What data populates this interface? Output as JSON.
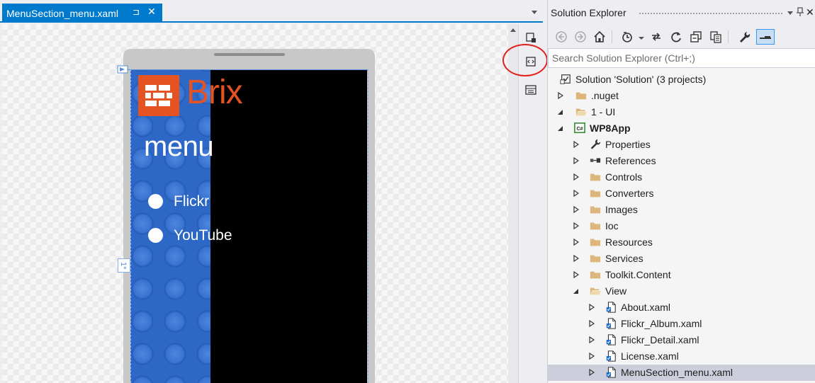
{
  "designer": {
    "tab": {
      "title": "MenuSection_menu.xaml",
      "pin_glyph": "⊐",
      "close_glyph": "✕"
    },
    "preview": {
      "app_name": "Brix",
      "page_title": "menu",
      "menu_items": [
        "Flickr",
        "YouTube"
      ],
      "row_marker": "1*"
    },
    "colors": {
      "accent": "#007acc",
      "brand": "#e55322",
      "annotation": "#e0201a"
    }
  },
  "solution_explorer": {
    "title": "Solution Explorer",
    "search_placeholder": "Search Solution Explorer (Ctrl+;)",
    "toolbar": [
      "back-icon",
      "forward-icon",
      "home-icon",
      "history-icon",
      "sync-icon",
      "refresh-icon",
      "collapse-all-icon",
      "show-all-files-icon",
      "properties-icon",
      "preview-icon"
    ],
    "tree": [
      {
        "label": "Solution 'Solution' (3 projects)",
        "icon": "solution-icon",
        "level": 0,
        "expander": "none"
      },
      {
        "label": ".nuget",
        "icon": "folder-icon",
        "level": 0,
        "expander": "collapsed"
      },
      {
        "label": "1 - UI",
        "icon": "folder-open-icon",
        "level": 0,
        "expander": "expanded"
      },
      {
        "label": "WP8App",
        "icon": "csharp-project-icon",
        "level": 1,
        "expander": "expanded",
        "bold": true
      },
      {
        "label": "Properties",
        "icon": "wrench-icon",
        "level": 2,
        "expander": "collapsed"
      },
      {
        "label": "References",
        "icon": "references-icon",
        "level": 2,
        "expander": "collapsed"
      },
      {
        "label": "Controls",
        "icon": "folder-icon",
        "level": 2,
        "expander": "collapsed"
      },
      {
        "label": "Converters",
        "icon": "folder-icon",
        "level": 2,
        "expander": "collapsed"
      },
      {
        "label": "Images",
        "icon": "folder-icon",
        "level": 2,
        "expander": "collapsed"
      },
      {
        "label": "Ioc",
        "icon": "folder-icon",
        "level": 2,
        "expander": "collapsed"
      },
      {
        "label": "Resources",
        "icon": "folder-icon",
        "level": 2,
        "expander": "collapsed"
      },
      {
        "label": "Services",
        "icon": "folder-icon",
        "level": 2,
        "expander": "collapsed"
      },
      {
        "label": "Toolkit.Content",
        "icon": "folder-icon",
        "level": 2,
        "expander": "collapsed"
      },
      {
        "label": "View",
        "icon": "folder-open-icon",
        "level": 2,
        "expander": "expanded"
      },
      {
        "label": "About.xaml",
        "icon": "xaml-file-icon",
        "level": 3,
        "expander": "collapsed"
      },
      {
        "label": "Flickr_Album.xaml",
        "icon": "xaml-file-icon",
        "level": 3,
        "expander": "collapsed"
      },
      {
        "label": "Flickr_Detail.xaml",
        "icon": "xaml-file-icon",
        "level": 3,
        "expander": "collapsed"
      },
      {
        "label": "License.xaml",
        "icon": "xaml-file-icon",
        "level": 3,
        "expander": "collapsed"
      },
      {
        "label": "MenuSection_menu.xaml",
        "icon": "xaml-file-icon",
        "level": 3,
        "expander": "collapsed",
        "selected": true
      }
    ]
  }
}
